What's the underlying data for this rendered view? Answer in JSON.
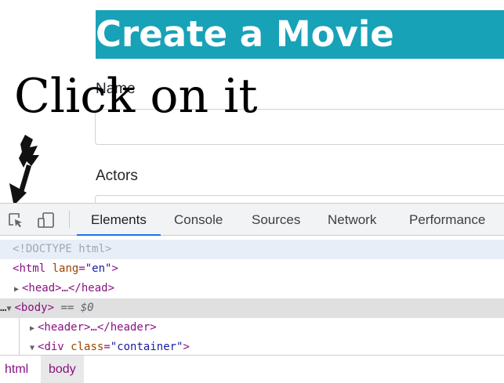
{
  "page": {
    "hero_title": "Create a Movie",
    "fields": [
      {
        "label": "Name",
        "value": ""
      },
      {
        "label": "Actors",
        "value": ""
      }
    ]
  },
  "annotation": {
    "text": "Click on it",
    "arrow_icon": "down-arrow-icon"
  },
  "devtools": {
    "toolbar_icons": [
      "inspect-element-icon",
      "device-toggle-icon"
    ],
    "tabs": [
      "Elements",
      "Console",
      "Sources",
      "Network",
      "Performance"
    ],
    "active_tab": "Elements",
    "dom": {
      "doctype": "<!DOCTYPE html>",
      "html_tag": "html",
      "html_attr": "lang",
      "html_val": "\"en\"",
      "head_text": "<head>…</head>",
      "body_tag": "<body>",
      "body_selected": "== $0",
      "header_text": "<header>…</header>",
      "div_tag": "div",
      "div_attr": "class",
      "div_val": "\"container\""
    },
    "breadcrumbs": [
      "html",
      "body"
    ],
    "accent_color": "#1a73e8"
  }
}
